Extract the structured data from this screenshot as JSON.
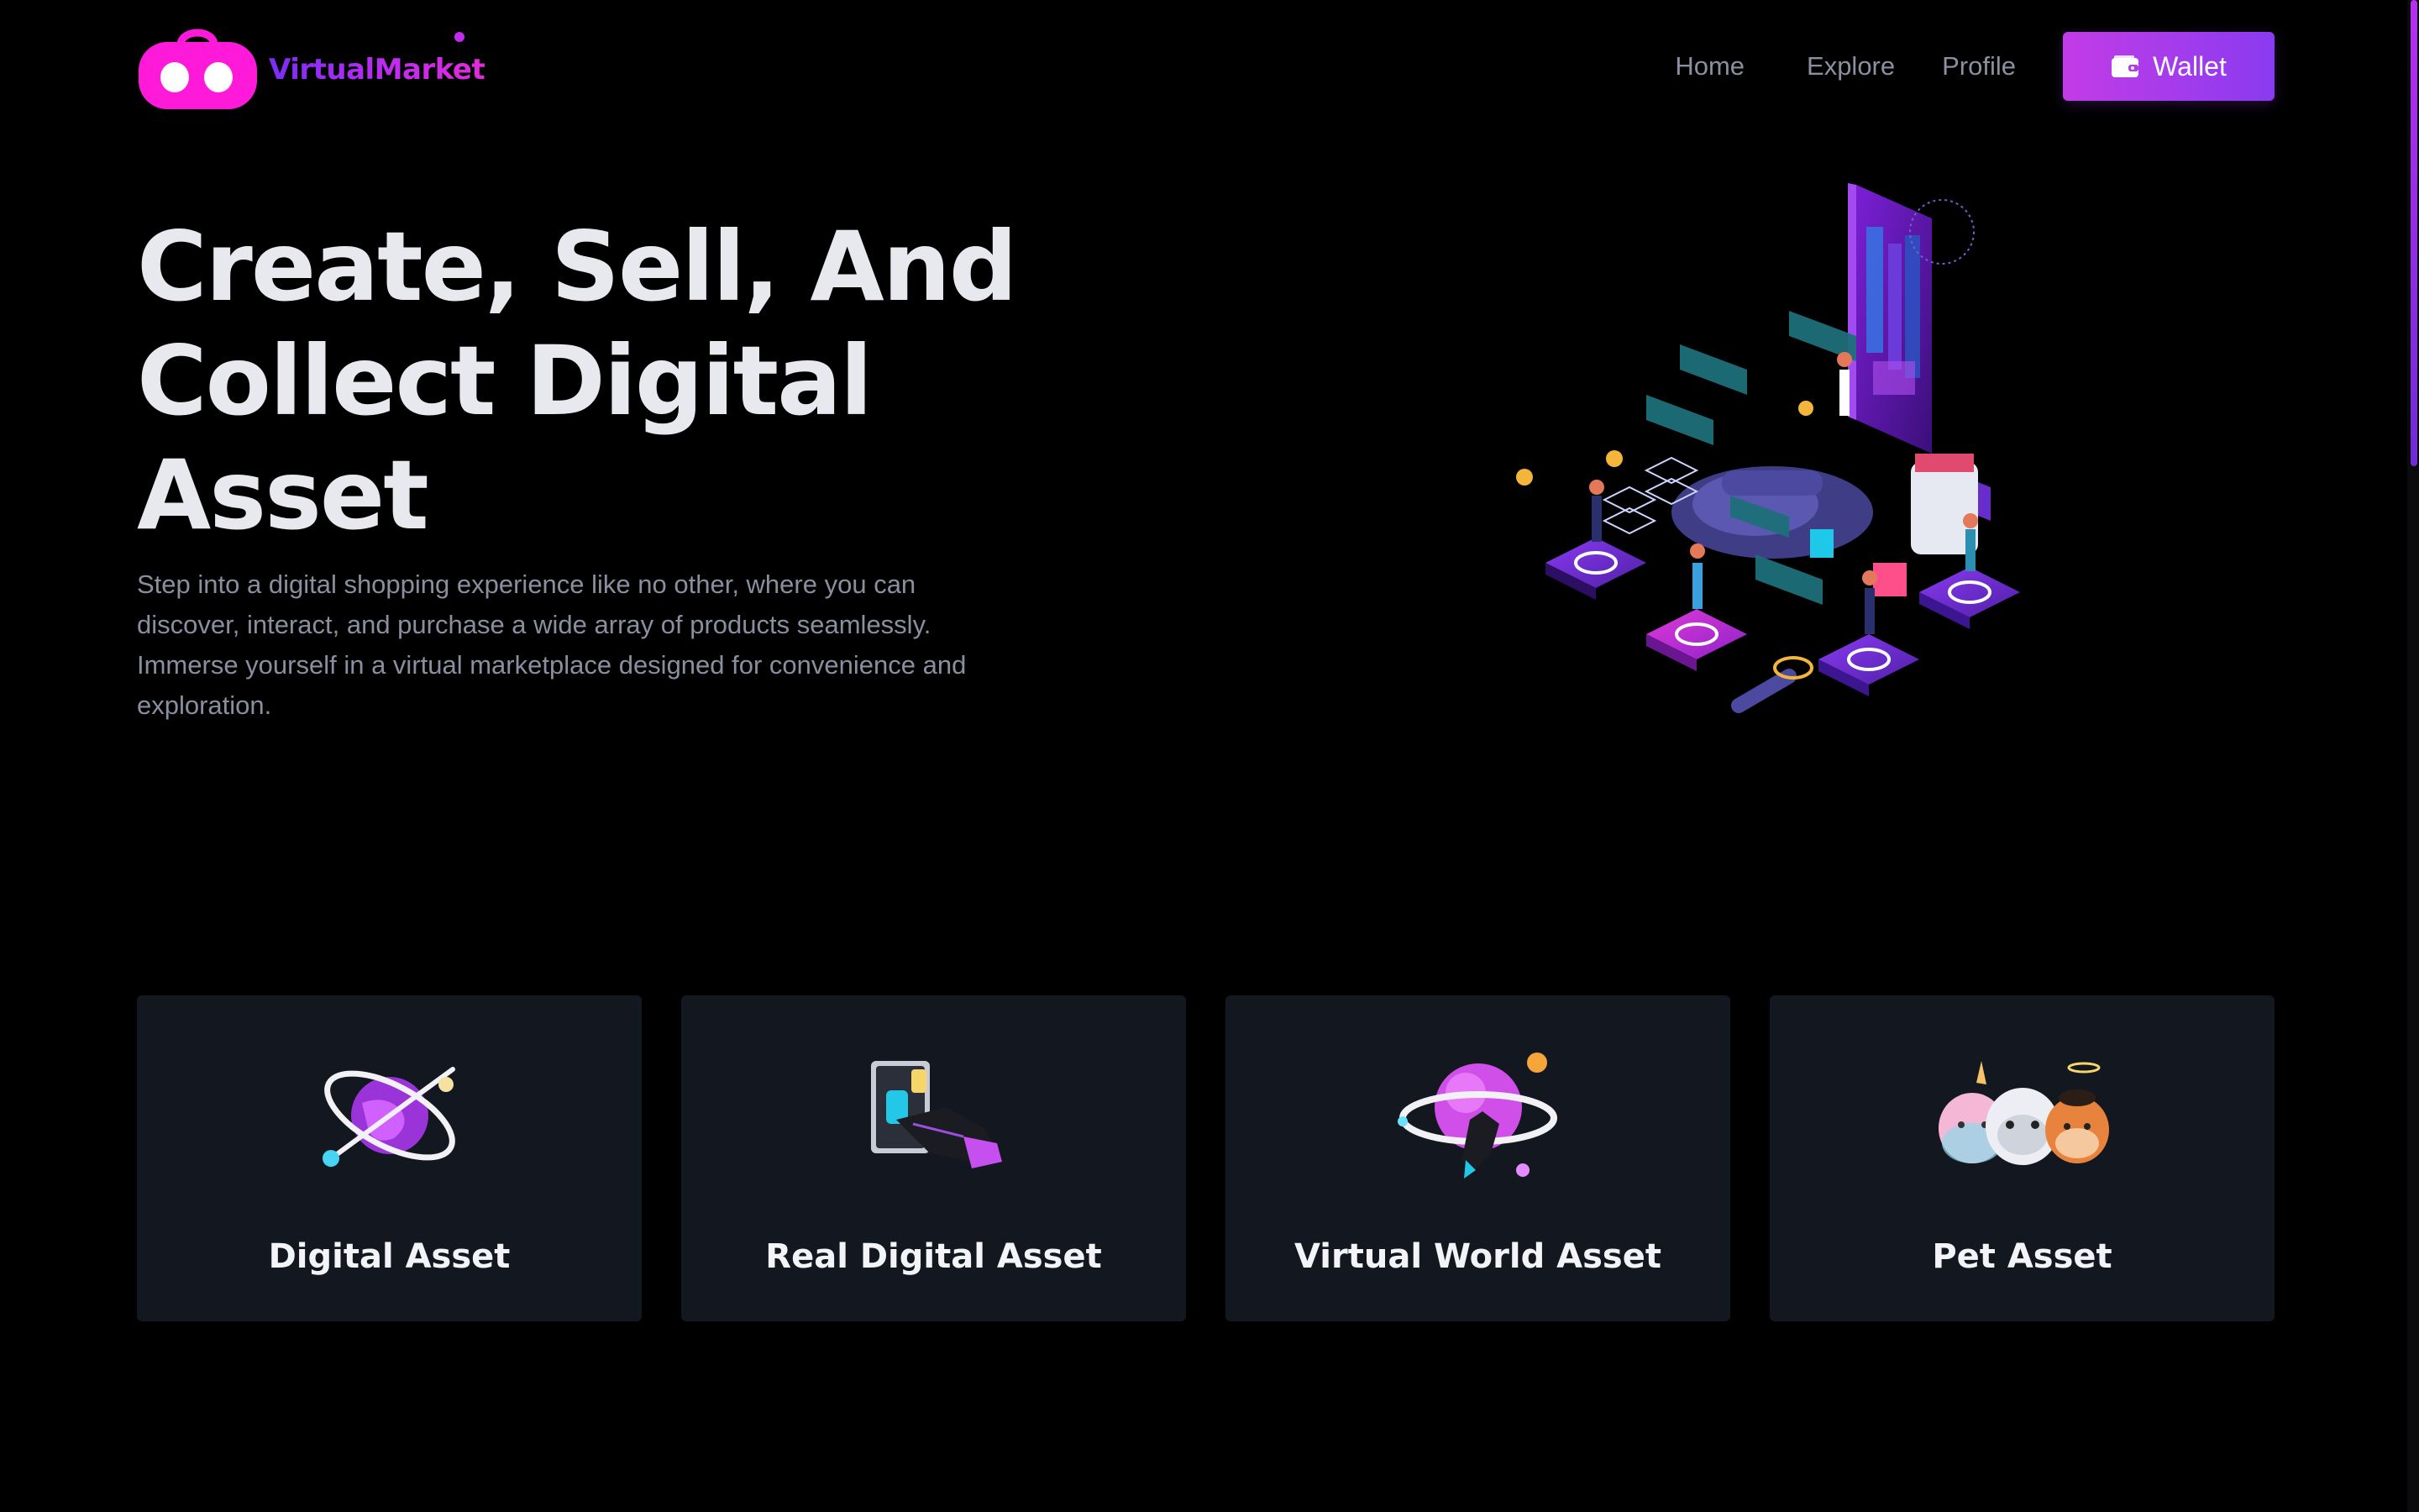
{
  "brand": {
    "name": "VirtualMarket",
    "colors": {
      "primary": "#ff1ad9",
      "accent": "#8a3bf0",
      "gradient_start": "#c23ce6"
    }
  },
  "nav": {
    "links": [
      "Home",
      "Explore",
      "Profile"
    ],
    "wallet_label": "Wallet",
    "wallet_icon": "wallet-icon"
  },
  "hero": {
    "title_lines": [
      "Create, Sell, And",
      "Collect Digital",
      "Asset"
    ],
    "description": "Step into a digital shopping experience like no other, where you can discover, interact, and purchase a wide array of products seamlessly. Immerse yourself in a virtual marketplace designed for convenience and exploration.",
    "illustration": "isometric-virtual-marketplace-illustration"
  },
  "categories": [
    {
      "label": "Digital Asset",
      "icon": "orbit-globe-icon"
    },
    {
      "label": "Real Digital Asset",
      "icon": "vr-hand-card-icon"
    },
    {
      "label": "Virtual World Asset",
      "icon": "planet-icon"
    },
    {
      "label": "Pet Asset",
      "icon": "pets-icon"
    }
  ]
}
